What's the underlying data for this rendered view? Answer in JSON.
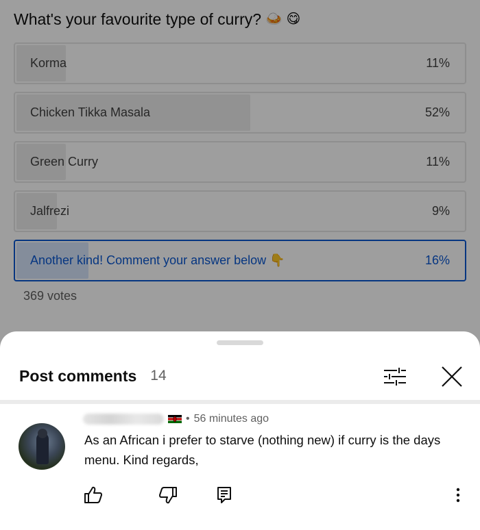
{
  "poll": {
    "question": "What's your favourite type of curry?",
    "question_emojis": "🍛 😋",
    "options": [
      {
        "label": "Korma",
        "percent_text": "11%",
        "fraction": 0.11,
        "selected": false
      },
      {
        "label": "Chicken Tikka Masala",
        "percent_text": "52%",
        "fraction": 0.52,
        "selected": false
      },
      {
        "label": "Green Curry",
        "percent_text": "11%",
        "fraction": 0.11,
        "selected": false
      },
      {
        "label": "Jalfrezi",
        "percent_text": "9%",
        "fraction": 0.09,
        "selected": false
      },
      {
        "label": "Another kind! Comment your answer below 👇",
        "percent_text": "16%",
        "fraction": 0.16,
        "selected": true
      }
    ],
    "votes": "369 votes"
  },
  "sheet": {
    "title": "Post comments",
    "count": "14",
    "icons": {
      "filter": "filter-sliders-icon",
      "close": "close-icon"
    }
  },
  "comment": {
    "flag": "kenya-flag",
    "separator": "•",
    "timestamp": "56 minutes ago",
    "text": "As an African i prefer to starve (nothing new) if curry is the days menu. Kind regards,",
    "actions": {
      "like": "thumbs-up-icon",
      "dislike": "thumbs-down-icon",
      "reply": "reply-icon",
      "more": "more-vertical-icon"
    }
  },
  "colors": {
    "accent": "#0b57d0",
    "selected_fill": "#d6e4fb",
    "bar_fill": "#ececec",
    "scrim": "rgba(0,0,0,0.38)"
  }
}
